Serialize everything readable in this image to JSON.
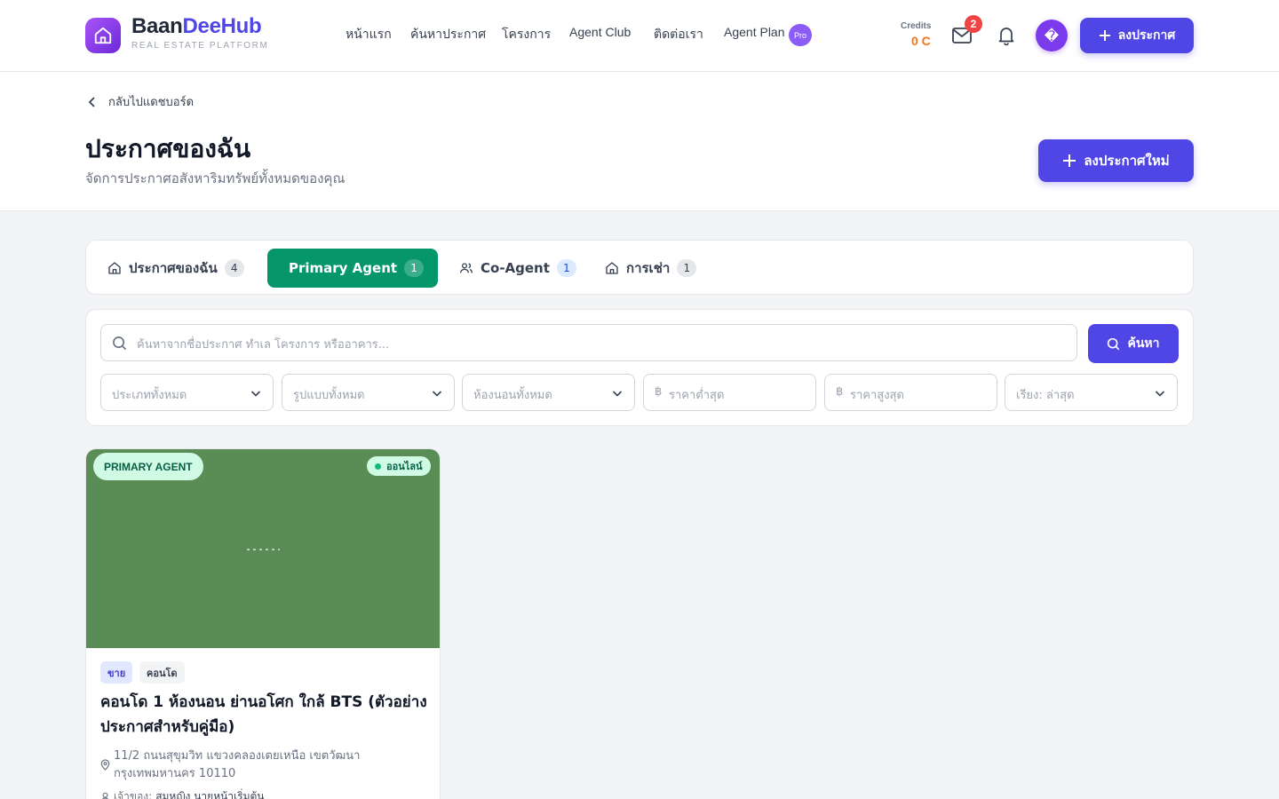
{
  "brand": {
    "name_part1": "Baan",
    "name_part2": "DeeHub",
    "tagline": "REAL ESTATE PLATFORM"
  },
  "nav": {
    "items": [
      "หน้าแรก",
      "ค้นหาประกาศ",
      "โครงการ",
      "Agent Club",
      "ติดต่อเรา",
      "Agent Plan"
    ],
    "pro_badge": "Pro"
  },
  "header": {
    "credits_label": "Credits",
    "credits_value": "0 C",
    "mail_count": "2",
    "avatar_glyph": "�",
    "post_button": "ลงประกาศ"
  },
  "page": {
    "back_label": "กลับไปแดชบอร์ด",
    "title": "ประกาศของฉัน",
    "subtitle": "จัดการประกาศอสังหาริมทรัพย์ทั้งหมดของคุณ",
    "new_button": "ลงประกาศใหม่"
  },
  "tabs": [
    {
      "label": "ประกาศของฉัน",
      "count": "4",
      "icon": "home-icon"
    },
    {
      "label": "Primary Agent",
      "count": "1",
      "icon": "users-icon",
      "active": true
    },
    {
      "label": "Co-Agent",
      "count": "1",
      "icon": "users-icon"
    },
    {
      "label": "การเช่า",
      "count": "1",
      "icon": "home-icon"
    }
  ],
  "filters": {
    "search_placeholder": "ค้นหาจากชื่อประกาศ ทำเล โครงการ หรืออาคาร...",
    "search_button": "ค้นหา",
    "selects": [
      "ประเภททั้งหมด",
      "รูปแบบทั้งหมด",
      "ห้องนอนทั้งหมด"
    ],
    "min_price_placeholder": "ราคาต่ำสุด",
    "max_price_placeholder": "ราคาสูงสุด",
    "currency_symbol": "฿",
    "sort": "เรียง: ล่าสุด"
  },
  "listing": {
    "role_badge": "PRIMARY AGENT",
    "status": "ออนไลน์",
    "deal_type": "ขาย",
    "property_type": "คอนโด",
    "title": "คอนโด 1 ห้องนอน ย่านอโศก ใกล้ BTS (ตัวอย่างประกาศสำหรับคู่มือ)",
    "address": "11/2 ถนนสุขุมวิท แขวงคลองเตยเหนือ เขตวัฒนา กรุงเทพมหานคร 10110",
    "owner_label": "เจ้าของ:",
    "owner_name": "สมหญิง นายหน้าเริ่มต้น"
  },
  "colors": {
    "accent": "#4f46e5",
    "tab_active": "#059669",
    "credits": "#f97316",
    "image_placeholder": "#5a8c55"
  }
}
